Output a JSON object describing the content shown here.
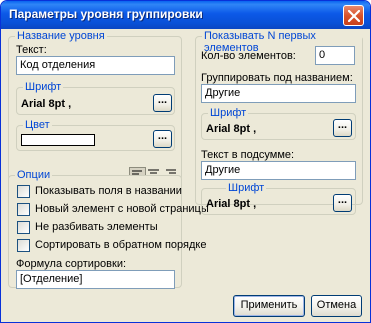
{
  "window": {
    "title": "Параметры уровня группировки"
  },
  "level_name": {
    "legend": "Название уровня",
    "text_label": "Текст:",
    "text_value": "Код отделения",
    "font_legend": "Шрифт",
    "font_value": "Arial 8pt ,",
    "font_button": "...",
    "color_legend": "Цвет",
    "color_value": "#ffffff",
    "color_button": "...",
    "alignment_selected": "left"
  },
  "options": {
    "legend": "Опции",
    "checkboxes": [
      {
        "label": "Показывать поля в названии",
        "checked": false
      },
      {
        "label": "Новый элемент с новой страницы",
        "checked": false
      },
      {
        "label": "Не разбивать элементы",
        "checked": false
      },
      {
        "label": "Сортировать в обратном порядке",
        "checked": false
      }
    ],
    "sort_formula_label": "Формула сортировки:",
    "sort_formula_value": "[Отделение]"
  },
  "top_n": {
    "legend": "Показывать N первых элементов",
    "count_label": "Кол-во элементов:",
    "count_value": "0",
    "group_name_label": "Группировать под названием:",
    "group_name_value": "Другие",
    "font_legend": "Шрифт",
    "font_value": "Arial 8pt ,",
    "font_button": "...",
    "subtotal_label": "Текст в подсумме:",
    "subtotal_value": "Другие",
    "subtotal_font_legend": "Шрифт",
    "subtotal_font_value": "Arial 8pt ,",
    "subtotal_font_button": "..."
  },
  "buttons": {
    "apply": "Применить",
    "cancel": "Отмена"
  }
}
